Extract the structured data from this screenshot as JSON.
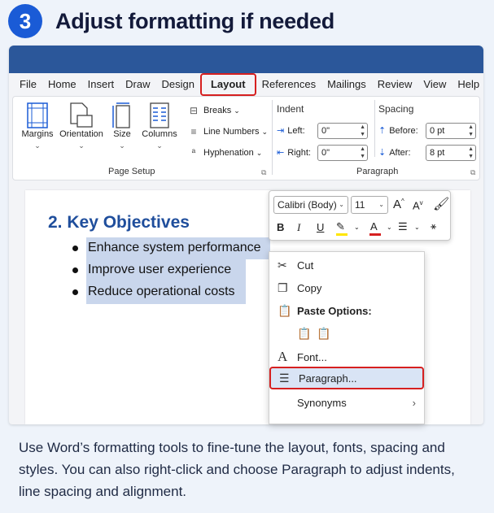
{
  "step": {
    "number": "3",
    "title": "Adjust formatting if needed"
  },
  "menu": [
    "File",
    "Home",
    "Insert",
    "Draw",
    "Design",
    "Layout",
    "References",
    "Mailings",
    "Review",
    "View",
    "Help"
  ],
  "ribbon": {
    "page_setup": {
      "label": "Page Setup",
      "margins": "Margins",
      "orientation": "Orientation",
      "size": "Size",
      "columns": "Columns",
      "breaks": "Breaks",
      "line_numbers": "Line Numbers",
      "hyphenation": "Hyphenation"
    },
    "paragraph": {
      "label": "Paragraph",
      "indent": "Indent",
      "left_label": "Left:",
      "left_value": "0\"",
      "right_label": "Right:",
      "right_value": "0\"",
      "spacing": "Spacing",
      "before_label": "Before:",
      "before_value": "0 pt",
      "after_label": "After:",
      "after_value": "8 pt"
    }
  },
  "document": {
    "heading": "2. Key Objectives",
    "bullets": [
      "Enhance system performance",
      "Improve user experience",
      "Reduce operational costs"
    ]
  },
  "mini_toolbar": {
    "font": "Calibri (Body)",
    "size": "11",
    "bold": "B",
    "italic": "I",
    "underline": "U",
    "grow": "A",
    "shrink": "A",
    "font_color_glyph": "A"
  },
  "context_menu": {
    "cut": "Cut",
    "copy": "Copy",
    "paste_options": "Paste Options:",
    "font": "Font...",
    "paragraph": "Paragraph...",
    "synonyms": "Synonyms"
  },
  "caption": "Use Word’s formatting tools to fine-tune the layout, fonts, spacing and styles. You can also right-click and choose Paragraph to adjust indents, line spacing and alignment.",
  "colors": {
    "accent": "#1a5bd6",
    "highlight_border": "#d62020",
    "selection": "#c9d6ec",
    "heading": "#1f4e9c"
  }
}
